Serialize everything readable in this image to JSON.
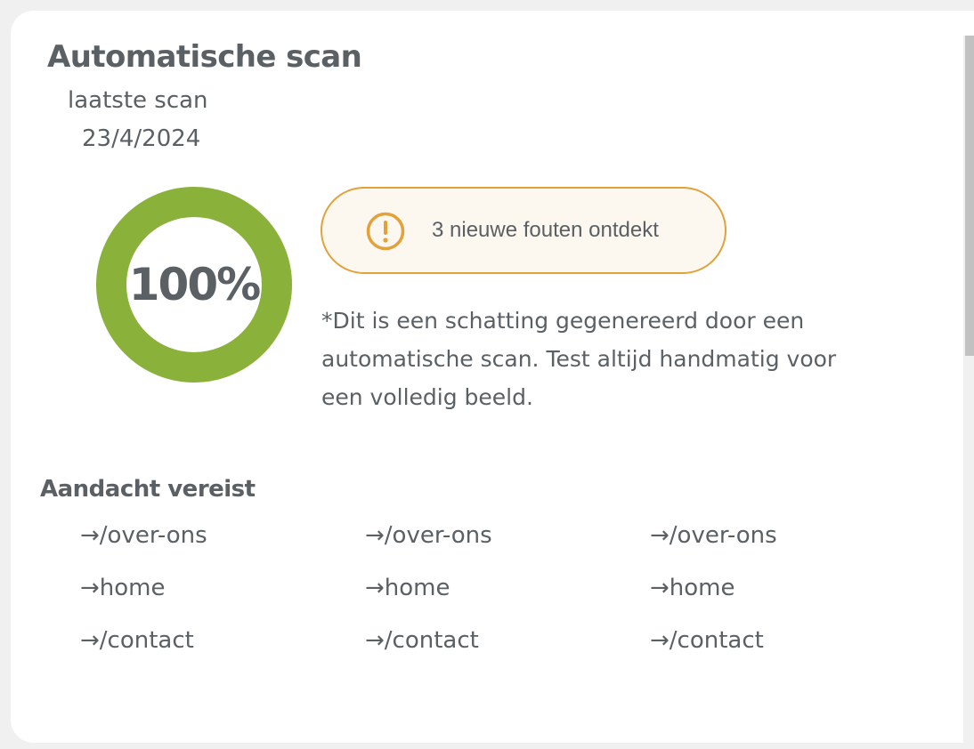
{
  "card": {
    "title": "Automatische scan",
    "last_scan_label": "laatste scan",
    "last_scan_date": "23/4/2024"
  },
  "score": {
    "value": 100,
    "label": "100%",
    "ring_color": "#8ab23b"
  },
  "alert": {
    "icon": "exclamation-circle-icon",
    "text": "3 nieuwe fouten ontdekt",
    "border_color": "#e3a13c",
    "background_color": "#fdf8ef"
  },
  "disclaimer": "*Dit is een schatting gegenereerd door een automatische scan. Test altijd handmatig voor een volledig beeld.",
  "attention": {
    "heading": "Aandacht vereist",
    "arrow": "→",
    "columns": [
      [
        "/over-ons",
        "home",
        "/contact"
      ],
      [
        "/over-ons",
        "home",
        "/contact"
      ],
      [
        "/over-ons",
        "home",
        "/contact"
      ]
    ]
  },
  "colors": {
    "text": "#5b6065",
    "accent_green": "#8ab23b",
    "warning_orange": "#e3a13c"
  }
}
